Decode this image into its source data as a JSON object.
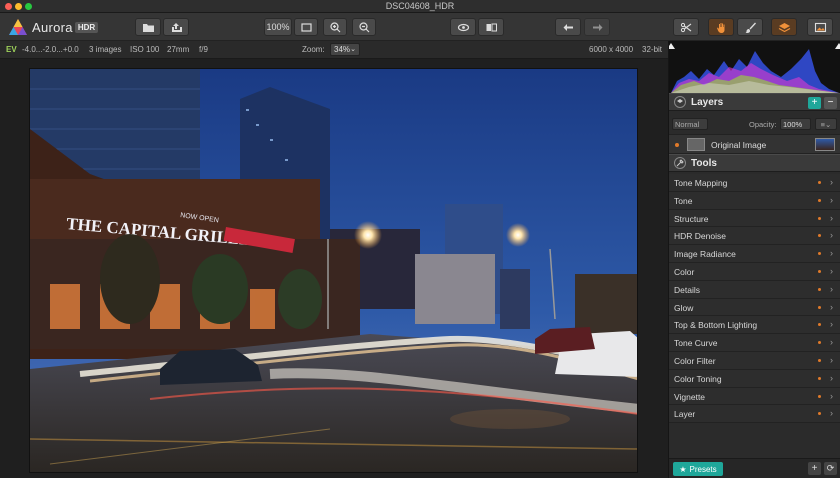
{
  "window": {
    "title": "DSC04608_HDR"
  },
  "app": {
    "name": "Aurora",
    "badge": "HDR"
  },
  "toolbar": {
    "zoom_label": "100%"
  },
  "info": {
    "ev_label": "EV",
    "ev_values": "-4.0...-2.0...+0.0",
    "images": "3 images",
    "iso": "ISO 100",
    "focal": "27mm",
    "aperture": "f/9",
    "zoom_label": "Zoom:",
    "zoom_value": "34%",
    "resolution": "6000 x 4000",
    "bit_depth": "32-bit"
  },
  "photo": {
    "signs": {
      "restaurant": "THE CAPITAL GRILLE",
      "now_open": "NOW OPEN"
    }
  },
  "layers": {
    "title": "Layers",
    "blend_mode": "Normal",
    "opacity_label": "Opacity:",
    "opacity_value": "100%",
    "items": [
      {
        "name": "Original Image"
      }
    ]
  },
  "tools": {
    "title": "Tools",
    "items": [
      "Tone Mapping",
      "Tone",
      "Structure",
      "HDR Denoise",
      "Image Radiance",
      "Color",
      "Details",
      "Glow",
      "Top & Bottom Lighting",
      "Tone Curve",
      "Color Filter",
      "Color Toning",
      "Vignette",
      "Layer"
    ]
  },
  "presets": {
    "label": "Presets"
  },
  "colors": {
    "accent": "#1fa79a",
    "dot": "#e07a2a",
    "ev": "#9fd35b"
  }
}
